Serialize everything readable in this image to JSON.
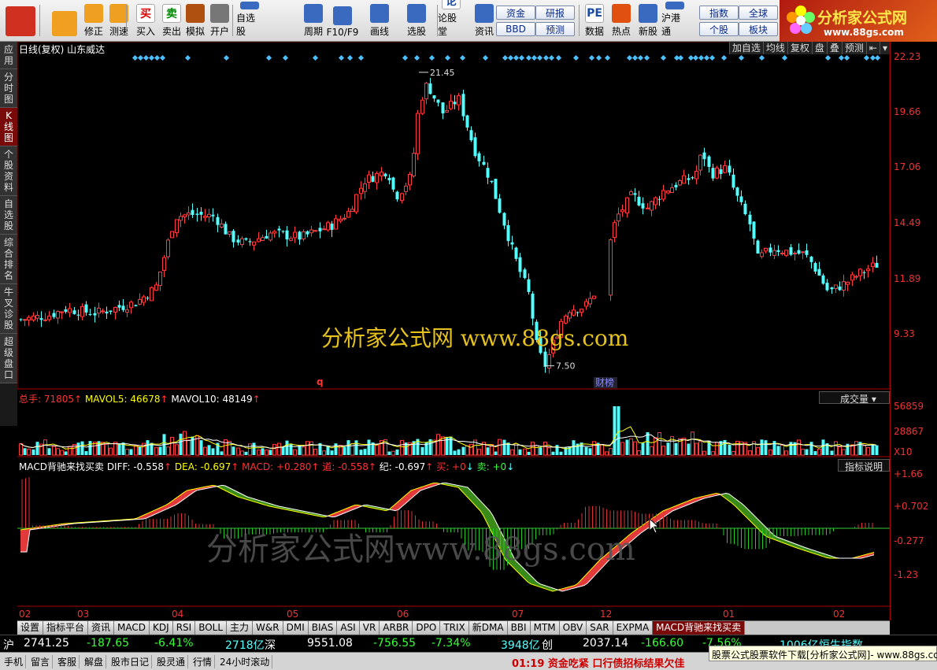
{
  "toolbar": {
    "buttons": [
      {
        "label": "",
        "icon": "windows-icon"
      },
      {
        "label": "",
        "icon": "back-arrow-icon"
      },
      {
        "label": "修正",
        "icon": "up-arrow-icon"
      },
      {
        "label": "测速",
        "icon": "refresh-icon"
      },
      {
        "label": "买入",
        "icon": "buy-icon",
        "glyph": "买"
      },
      {
        "label": "卖出",
        "icon": "sell-icon",
        "glyph": "卖"
      },
      {
        "label": "模拟",
        "icon": "hammer-icon"
      },
      {
        "label": "开户",
        "icon": "lock-icon"
      },
      {
        "label": "自选股",
        "icon": "star-folder-icon"
      },
      {
        "label": "周期",
        "icon": "clock-icon"
      },
      {
        "label": "F10/F9",
        "icon": "f10-icon"
      },
      {
        "label": "画线",
        "icon": "pencil-icon"
      },
      {
        "label": "选股",
        "icon": "stock-select-icon"
      },
      {
        "label": "论股堂",
        "icon": "forum-icon",
        "glyph": "论"
      },
      {
        "label": "资讯",
        "icon": "news-icon"
      },
      {
        "label": "数据",
        "icon": "pe-icon",
        "glyph": "PE"
      },
      {
        "label": "热点",
        "icon": "fire-icon"
      },
      {
        "label": "新股",
        "icon": "new-stock-icon"
      },
      {
        "label": "沪港通",
        "icon": "hk-connect-icon"
      }
    ],
    "small_buttons": [
      "资金",
      "研报",
      "BBD",
      "预测",
      "指数",
      "全球",
      "个股",
      "板块"
    ],
    "logo_title": "分析家公式网",
    "logo_url": "www.88gs.com"
  },
  "left_tabs": [
    {
      "label": "应用",
      "active": false
    },
    {
      "label": "分时图",
      "active": false
    },
    {
      "label": "K线图",
      "active": true
    },
    {
      "label": "个股资料",
      "active": false
    },
    {
      "label": "自选股",
      "active": false
    },
    {
      "label": "综合排名",
      "active": false
    },
    {
      "label": "牛叉诊股",
      "active": false
    },
    {
      "label": "超级盘口",
      "active": false
    }
  ],
  "chart_header": {
    "title": "日线(复权) 山东威达"
  },
  "top_right_buttons": [
    "加自选",
    "均线",
    "复权",
    "盘",
    "叠",
    "预测",
    "⇤",
    "▾"
  ],
  "price_axis": [
    "22.23",
    "19.66",
    "17.06",
    "14.49",
    "11.89",
    "9.33"
  ],
  "volume_axis": [
    "56859",
    "28867",
    "X10"
  ],
  "macd_axis": [
    "+1.66",
    "+0.702",
    "-0.277",
    "-1.23"
  ],
  "volume_info": {
    "total": "总手: 71805",
    "mavol5": "MAVOL5: 46678",
    "mavol10": "MAVOL10: 48149",
    "dropdown": "成交量"
  },
  "macd_info": {
    "name": "MACD背驰来找买卖",
    "diff": "DIFF: -0.558",
    "dea": "DEA: -0.697",
    "macd": "MACD: +0.280",
    "dao": "道: -0.558",
    "ji": "纪: -0.697",
    "buy": "买: +0",
    "sell": "卖: +0",
    "help": "指标说明"
  },
  "annotations": {
    "high": "21.45",
    "low": "7.50",
    "q": "q",
    "caibang": "财榜"
  },
  "x_axis": [
    "02",
    "03",
    "04",
    "05",
    "06",
    "07",
    "12",
    "01",
    "02"
  ],
  "watermarks": {
    "main": "分析家公式网 www.88gs.com",
    "macd": "分析家公式网www.88gs.com"
  },
  "bottom_tabs": [
    "设置",
    "指标平台",
    "资讯",
    "MACD",
    "KDJ",
    "RSI",
    "BOLL",
    "主力",
    "W&R",
    "DMI",
    "BIAS",
    "ASI",
    "VR",
    "ARBR",
    "DPO",
    "TRIX",
    "新DMA",
    "BBI",
    "MTM",
    "OBV",
    "SAR",
    "EXPMA",
    "MACD背驰来找买卖"
  ],
  "status1": {
    "sh_label": "沪",
    "sh_index": "2741.25",
    "sh_change": "-187.65",
    "sh_pct": "-6.41%",
    "sh_amount": "2718亿",
    "sz_label": "深",
    "sz_index": "9551.08",
    "sz_change": "-756.55",
    "sz_pct": "-7.34%",
    "sz_amount": "3948亿",
    "cy_label": "创",
    "cy_index": "2037.14",
    "cy_change": "-166.60",
    "cy_pct": "-7.56%",
    "cy_amount": "1006亿",
    "hk_label": "恒生指数"
  },
  "status2": {
    "items": [
      "手机",
      "留言",
      "客服",
      "解盘",
      "股市日记",
      "股灵通",
      "行情",
      "24小时滚动"
    ],
    "marquee": "01:19 资金吃紧 口行债招标结果欠佳",
    "ad": "股票公式股票软件下载[分析家公式网]- www.88gs.com"
  }
}
